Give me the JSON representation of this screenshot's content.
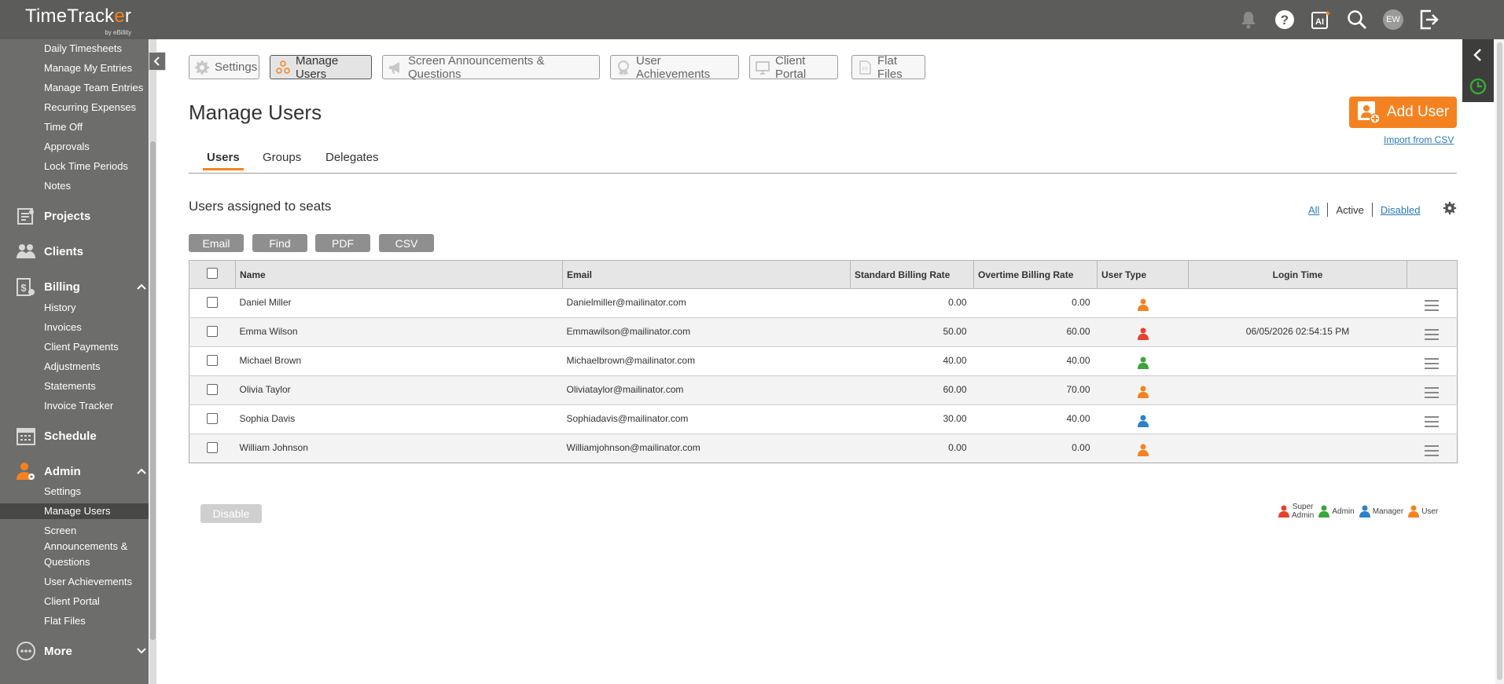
{
  "app": {
    "logo_main_a": "TimeTrack",
    "logo_main_o": "e",
    "logo_main_b": "r",
    "logo_sub": "by eBillity",
    "avatar_initials": "EW"
  },
  "topbar_icons": [
    "bell-icon",
    "help-icon",
    "ai-icon",
    "search-icon",
    "avatar",
    "logout-icon"
  ],
  "sidebar": {
    "time_items": [
      "Daily Timesheets",
      "Manage My Entries",
      "Manage Team Entries",
      "Recurring Expenses",
      "Time Off",
      "Approvals",
      "Lock Time Periods",
      "Notes"
    ],
    "projects": "Projects",
    "clients": "Clients",
    "billing": "Billing",
    "billing_items": [
      "History",
      "Invoices",
      "Client Payments",
      "Adjustments",
      "Statements",
      "Invoice Tracker"
    ],
    "schedule": "Schedule",
    "admin": "Admin",
    "admin_items": [
      "Settings",
      "Manage Users",
      "Screen",
      "Announcements &",
      "Questions",
      "User Achievements",
      "Client Portal",
      "Flat Files"
    ],
    "more": "More"
  },
  "nav_buttons": [
    "Settings",
    "Manage Users",
    "Screen Announcements & Questions",
    "User Achievements",
    "Client Portal",
    "Flat Files"
  ],
  "page_title": "Manage Users",
  "add_user_label": "Add User",
  "import_label": "Import from CSV",
  "tabs": [
    "Users",
    "Groups",
    "Delegates"
  ],
  "section_title": "Users assigned to seats",
  "filters": [
    "All",
    "Active",
    "Disabled"
  ],
  "export_buttons": [
    "Email",
    "Find",
    "PDF",
    "CSV"
  ],
  "table": {
    "headers": [
      "Name",
      "Email",
      "Standard Billing Rate",
      "Overtime Billing Rate",
      "User Type",
      "Login Time"
    ],
    "rows": [
      {
        "name": "Daniel Miller",
        "email": "Danielmiller@mailinator.com",
        "std": "0.00",
        "ot": "0.00",
        "type": "user",
        "login": ""
      },
      {
        "name": "Emma Wilson",
        "email": "Emmawilson@mailinator.com",
        "std": "50.00",
        "ot": "60.00",
        "type": "super-admin",
        "login": "06/05/2026 02:54:15 PM"
      },
      {
        "name": "Michael Brown",
        "email": "Michaelbrown@mailinator.com",
        "std": "40.00",
        "ot": "40.00",
        "type": "admin",
        "login": ""
      },
      {
        "name": "Olivia Taylor",
        "email": "Oliviataylor@mailinator.com",
        "std": "60.00",
        "ot": "70.00",
        "type": "user",
        "login": ""
      },
      {
        "name": "Sophia Davis",
        "email": "Sophiadavis@mailinator.com",
        "std": "30.00",
        "ot": "40.00",
        "type": "manager",
        "login": ""
      },
      {
        "name": "William Johnson",
        "email": "Williamjohnson@mailinator.com",
        "std": "0.00",
        "ot": "0.00",
        "type": "user",
        "login": ""
      }
    ]
  },
  "disable_label": "Disable",
  "legend": {
    "super_admin_1": "Super",
    "super_admin_2": "Admin",
    "admin": "Admin",
    "manager": "Manager",
    "user": "User"
  },
  "colors": {
    "accent": "#f58220",
    "super_admin": "#e8412c",
    "admin": "#3aa63a",
    "manager": "#2a82c8",
    "user": "#f58220",
    "link": "#2a7ab8"
  }
}
